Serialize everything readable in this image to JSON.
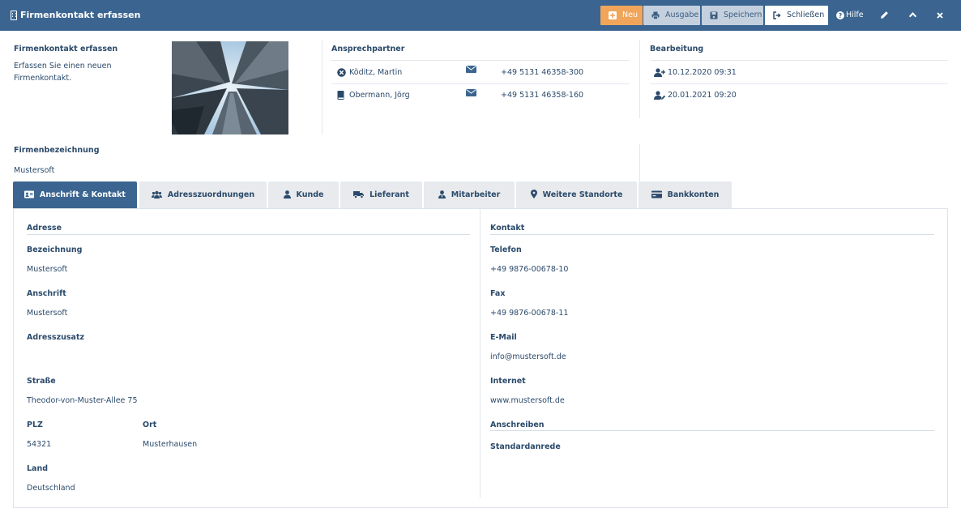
{
  "window": {
    "title": "Firmenkontakt erfassen",
    "icon": "building-icon"
  },
  "toolbar": {
    "new_label": "Neu",
    "output_label": "Ausgabe",
    "save_label": "Speichern",
    "close_label": "Schließen",
    "help_label": "Hilfe",
    "edit_icon": "pencil-icon",
    "collapse_icon": "chevron-up-icon",
    "close_icon": "close-icon"
  },
  "intro": {
    "heading": "Firmenkontakt erfassen",
    "line1": "Erfassen Sie einen neuen",
    "line2": "Firmenkontakt."
  },
  "contacts": {
    "heading": "Ansprechpartner",
    "items": [
      {
        "name": "Köditz, Martin",
        "icon": "x-circle-icon",
        "mail_icon": "envelope-icon",
        "phone": "+49 5131 46358-300"
      },
      {
        "name": "Obermann, Jörg",
        "icon": "book-icon",
        "mail_icon": "envelope-icon",
        "phone": "+49 5131 46358-160"
      }
    ]
  },
  "editing": {
    "heading": "Bearbeitung",
    "created": "10.12.2020 09:31",
    "modified": "20.01.2021 09:20"
  },
  "company": {
    "label": "Firmenbezeichnung",
    "value": "Mustersoft"
  },
  "tabs": [
    {
      "label": "Anschrift & Kontakt",
      "icon": "id-card-icon"
    },
    {
      "label": "Adresszuordnungen",
      "icon": "users-icon"
    },
    {
      "label": "Kunde",
      "icon": "user-icon"
    },
    {
      "label": "Lieferant",
      "icon": "truck-icon"
    },
    {
      "label": "Mitarbeiter",
      "icon": "user-tie-icon"
    },
    {
      "label": "Weitere Standorte",
      "icon": "map-marker-icon"
    },
    {
      "label": "Bankkonten",
      "icon": "credit-card-icon"
    }
  ],
  "address": {
    "section": "Adresse",
    "designation_label": "Bezeichnung",
    "designation": "Mustersoft",
    "salutation_label": "Anschrift",
    "salutation": "Mustersoft",
    "addition_label": "Adresszusatz",
    "addition": "",
    "street_label": "Straße",
    "street": "Theodor-von-Muster-Allee 75",
    "zip_label": "PLZ",
    "zip": "54321",
    "city_label": "Ort",
    "city": "Musterhausen",
    "country_label": "Land",
    "country": "Deutschland"
  },
  "contact": {
    "section": "Kontakt",
    "phone_label": "Telefon",
    "phone": "+49 9876-00678-10",
    "fax_label": "Fax",
    "fax": "+49 9876-00678-11",
    "email_label": "E-Mail",
    "email": "info@mustersoft.de",
    "web_label": "Internet",
    "web": "www.mustersoft.de"
  },
  "letter": {
    "section": "Anschreiben",
    "salutation_label": "Standardanrede"
  }
}
